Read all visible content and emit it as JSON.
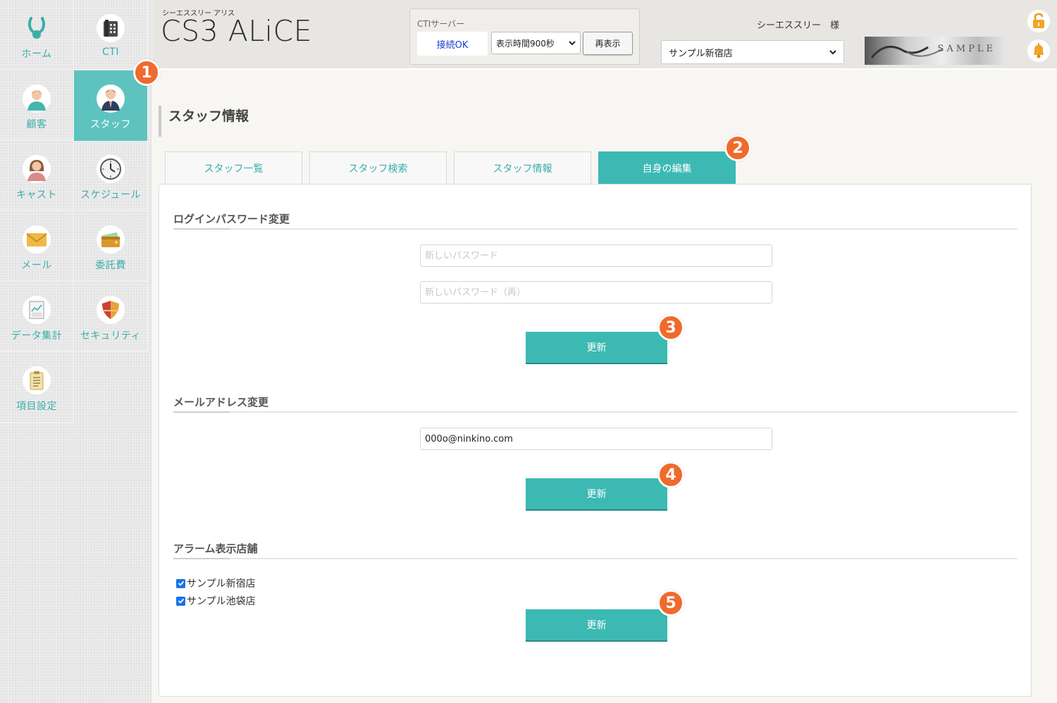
{
  "sidebar": {
    "items": [
      {
        "label": "ホーム",
        "icon": "bunny-icon"
      },
      {
        "label": "CTI",
        "icon": "phone-icon"
      },
      {
        "label": "顧客",
        "icon": "customer-icon"
      },
      {
        "label": "スタッフ",
        "icon": "staff-icon",
        "active": true
      },
      {
        "label": "キャスト",
        "icon": "cast-icon"
      },
      {
        "label": "スケジュール",
        "icon": "clock-icon"
      },
      {
        "label": "メール",
        "icon": "mail-icon"
      },
      {
        "label": "委託費",
        "icon": "wallet-icon"
      },
      {
        "label": "データ集計",
        "icon": "report-icon"
      },
      {
        "label": "セキュリティ",
        "icon": "shield-icon"
      },
      {
        "label": "項目設定",
        "icon": "clipboard-icon"
      }
    ]
  },
  "header": {
    "brand_sub": "シーエススリー アリス",
    "brand_title": "CS3 ALiCE",
    "cti": {
      "label": "CTIサーバー",
      "status": "接続OK",
      "display_time": "表示時間900秒",
      "refresh": "再表示"
    },
    "user_name": "シーエススリー　様",
    "store_select": "サンプル新宿店",
    "banner_text": "SAMPLE"
  },
  "main": {
    "page_title": "スタッフ情報",
    "tabs": [
      {
        "label": "スタッフ一覧"
      },
      {
        "label": "スタッフ検索"
      },
      {
        "label": "スタッフ情報"
      },
      {
        "label": "自身の編集",
        "active": true
      }
    ],
    "password_section": {
      "title": "ログインパスワード変更",
      "new_password_placeholder": "新しいパスワード",
      "confirm_password_placeholder": "新しいパスワード（再）",
      "update": "更新"
    },
    "email_section": {
      "title": "メールアドレス変更",
      "email_value": "000o@ninkino.com",
      "update": "更新"
    },
    "alarm_section": {
      "title": "アラーム表示店舗",
      "stores": [
        {
          "label": "サンプル新宿店",
          "checked": true
        },
        {
          "label": "サンプル池袋店",
          "checked": true
        }
      ],
      "update": "更新"
    }
  },
  "markers": [
    "1",
    "2",
    "3",
    "4",
    "5"
  ],
  "colors": {
    "accent": "#3db9b3",
    "sidebar_active": "#5ec3bf",
    "marker": "#ef6a2c",
    "link_blue": "#1a3ccf"
  }
}
